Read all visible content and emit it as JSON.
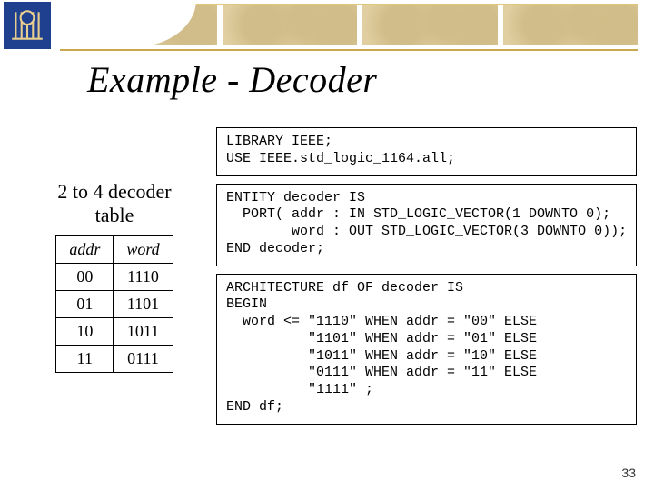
{
  "title": "Example - Decoder",
  "table_caption_line1": "2 to 4 decoder",
  "table_caption_line2": "table",
  "page_number": "33",
  "truth_table": {
    "headers": [
      "addr",
      "word"
    ],
    "rows": [
      [
        "00",
        "1110"
      ],
      [
        "01",
        "1101"
      ],
      [
        "10",
        "1011"
      ],
      [
        "11",
        "0111"
      ]
    ]
  },
  "codebox1": "LIBRARY IEEE;\nUSE IEEE.std_logic_1164.all;",
  "codebox2": "ENTITY decoder IS\n  PORT( addr : IN STD_LOGIC_VECTOR(1 DOWNTO 0);\n        word : OUT STD_LOGIC_VECTOR(3 DOWNTO 0));\nEND decoder;",
  "codebox3": "ARCHITECTURE df OF decoder IS\nBEGIN\n  word <= \"1110\" WHEN addr = \"00\" ELSE\n          \"1101\" WHEN addr = \"01\" ELSE\n          \"1011\" WHEN addr = \"10\" ELSE\n          \"0111\" WHEN addr = \"11\" ELSE\n          \"1111\" ;\nEND df;"
}
